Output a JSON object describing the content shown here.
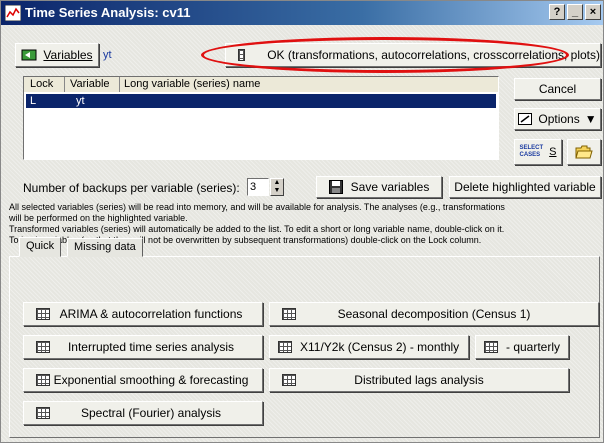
{
  "window": {
    "title": "Time Series Analysis: cv11",
    "help_glyph": "?",
    "minimize_glyph": "_",
    "close_glyph": "×"
  },
  "variables_button": {
    "label": "Variables"
  },
  "variables_value": "yt",
  "ok_button": {
    "label": "OK (transformations, autocorrelations, crosscorrelations, plots)"
  },
  "cancel_button": {
    "label": "Cancel"
  },
  "options_button": {
    "label": "Options"
  },
  "select_cases_button": {
    "line1": "SELECT",
    "line2": "CASES",
    "suffix": "S"
  },
  "variable_list": {
    "columns": [
      "Lock",
      "Variable",
      "Long variable (series) name"
    ],
    "rows": [
      {
        "lock": "L",
        "variable": "yt",
        "long_name": ""
      }
    ]
  },
  "backups": {
    "label": "Number of backups per variable (series):",
    "value": "3"
  },
  "save_variables_button": {
    "label": "Save variables"
  },
  "delete_button": {
    "label": "Delete highlighted variable"
  },
  "info_text": {
    "line1": "All selected variables (series) will be read into memory, and will be available for analysis. The analyses (e.g., transformations",
    "line2": "will be performed on the highlighted variable.",
    "line3": "Transformed variables (series) will automatically be added to the list. To edit a short or long variable name, double-click on it.",
    "line4": "To Lock variables (so that they will not be overwritten by subsequent transformations) double-click on the Lock column."
  },
  "tabs": [
    {
      "label": "Quick"
    },
    {
      "label": "Missing data"
    }
  ],
  "analysis_buttons": {
    "arima": "ARIMA & autocorrelation functions",
    "seasonal": "Seasonal decomposition (Census 1)",
    "interrupted": "Interrupted time series analysis",
    "x11_monthly": "X11/Y2k (Census 2) - monthly",
    "quarterly": "- quarterly",
    "exponential": "Exponential smoothing & forecasting",
    "distributed": "Distributed lags analysis",
    "spectral": "Spectral (Fourier) analysis"
  },
  "colors": {
    "selection": "#0a246a",
    "title_gradient_start": "#0b246a",
    "annotation_ellipse": "#e01010"
  },
  "icons": {
    "app": "chart-icon",
    "variables": "variables-icon",
    "ok": "table-icon",
    "options": "options-icon",
    "open": "folder-open-icon",
    "save": "save-icon"
  }
}
